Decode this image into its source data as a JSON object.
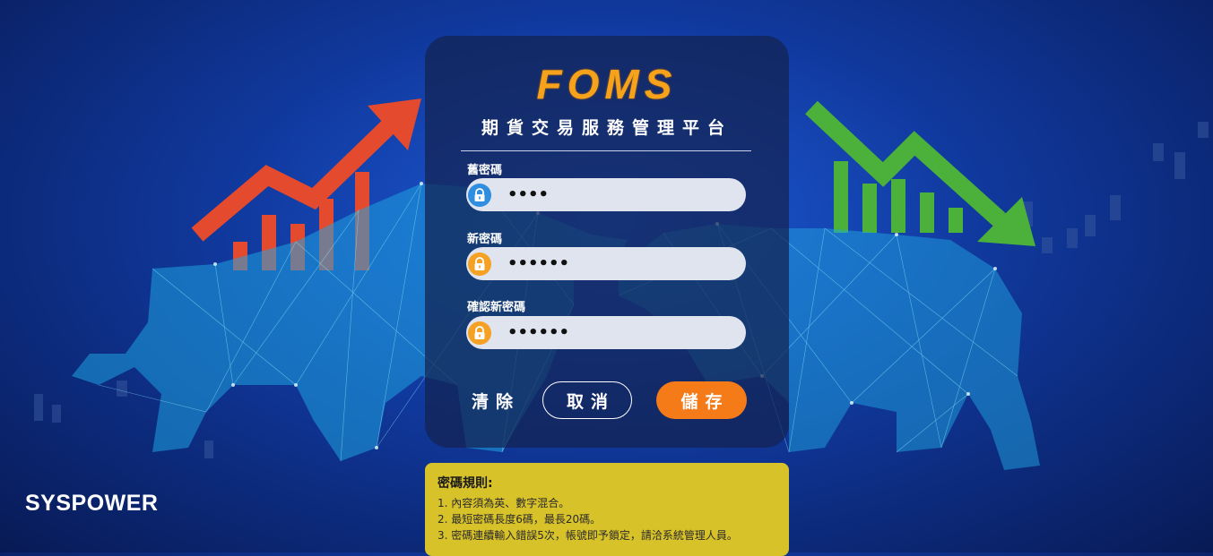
{
  "brand": "SYSPOWER",
  "logo": "FOMS",
  "subtitle": "期貨交易服務管理平台",
  "fields": [
    {
      "label": "舊密碼",
      "value": "••••",
      "icon": "lock-icon",
      "icon_color": "#2f8ee0"
    },
    {
      "label": "新密碼",
      "value": "••••••",
      "icon": "lock-icon",
      "icon_color": "#f5a123"
    },
    {
      "label": "確認新密碼",
      "value": "••••••",
      "icon": "lock-icon",
      "icon_color": "#f5a123"
    }
  ],
  "buttons": {
    "clear": "清除",
    "cancel": "取消",
    "save": "儲存"
  },
  "rules": {
    "title": "密碼規則:",
    "items": [
      "1. 內容須為英、數字混合。",
      "2. 最短密碼長度6碼，最長20碼。",
      "3. 密碼連續輸入錯誤5次，帳號即予鎖定，請洽系統管理人員。"
    ]
  },
  "colors": {
    "accent": "#f57a18",
    "logo": "#f7a21b",
    "rules_bg": "#d8c22a",
    "bull_arrow": "#e44a2e",
    "bear_arrow": "#4bb13a"
  }
}
